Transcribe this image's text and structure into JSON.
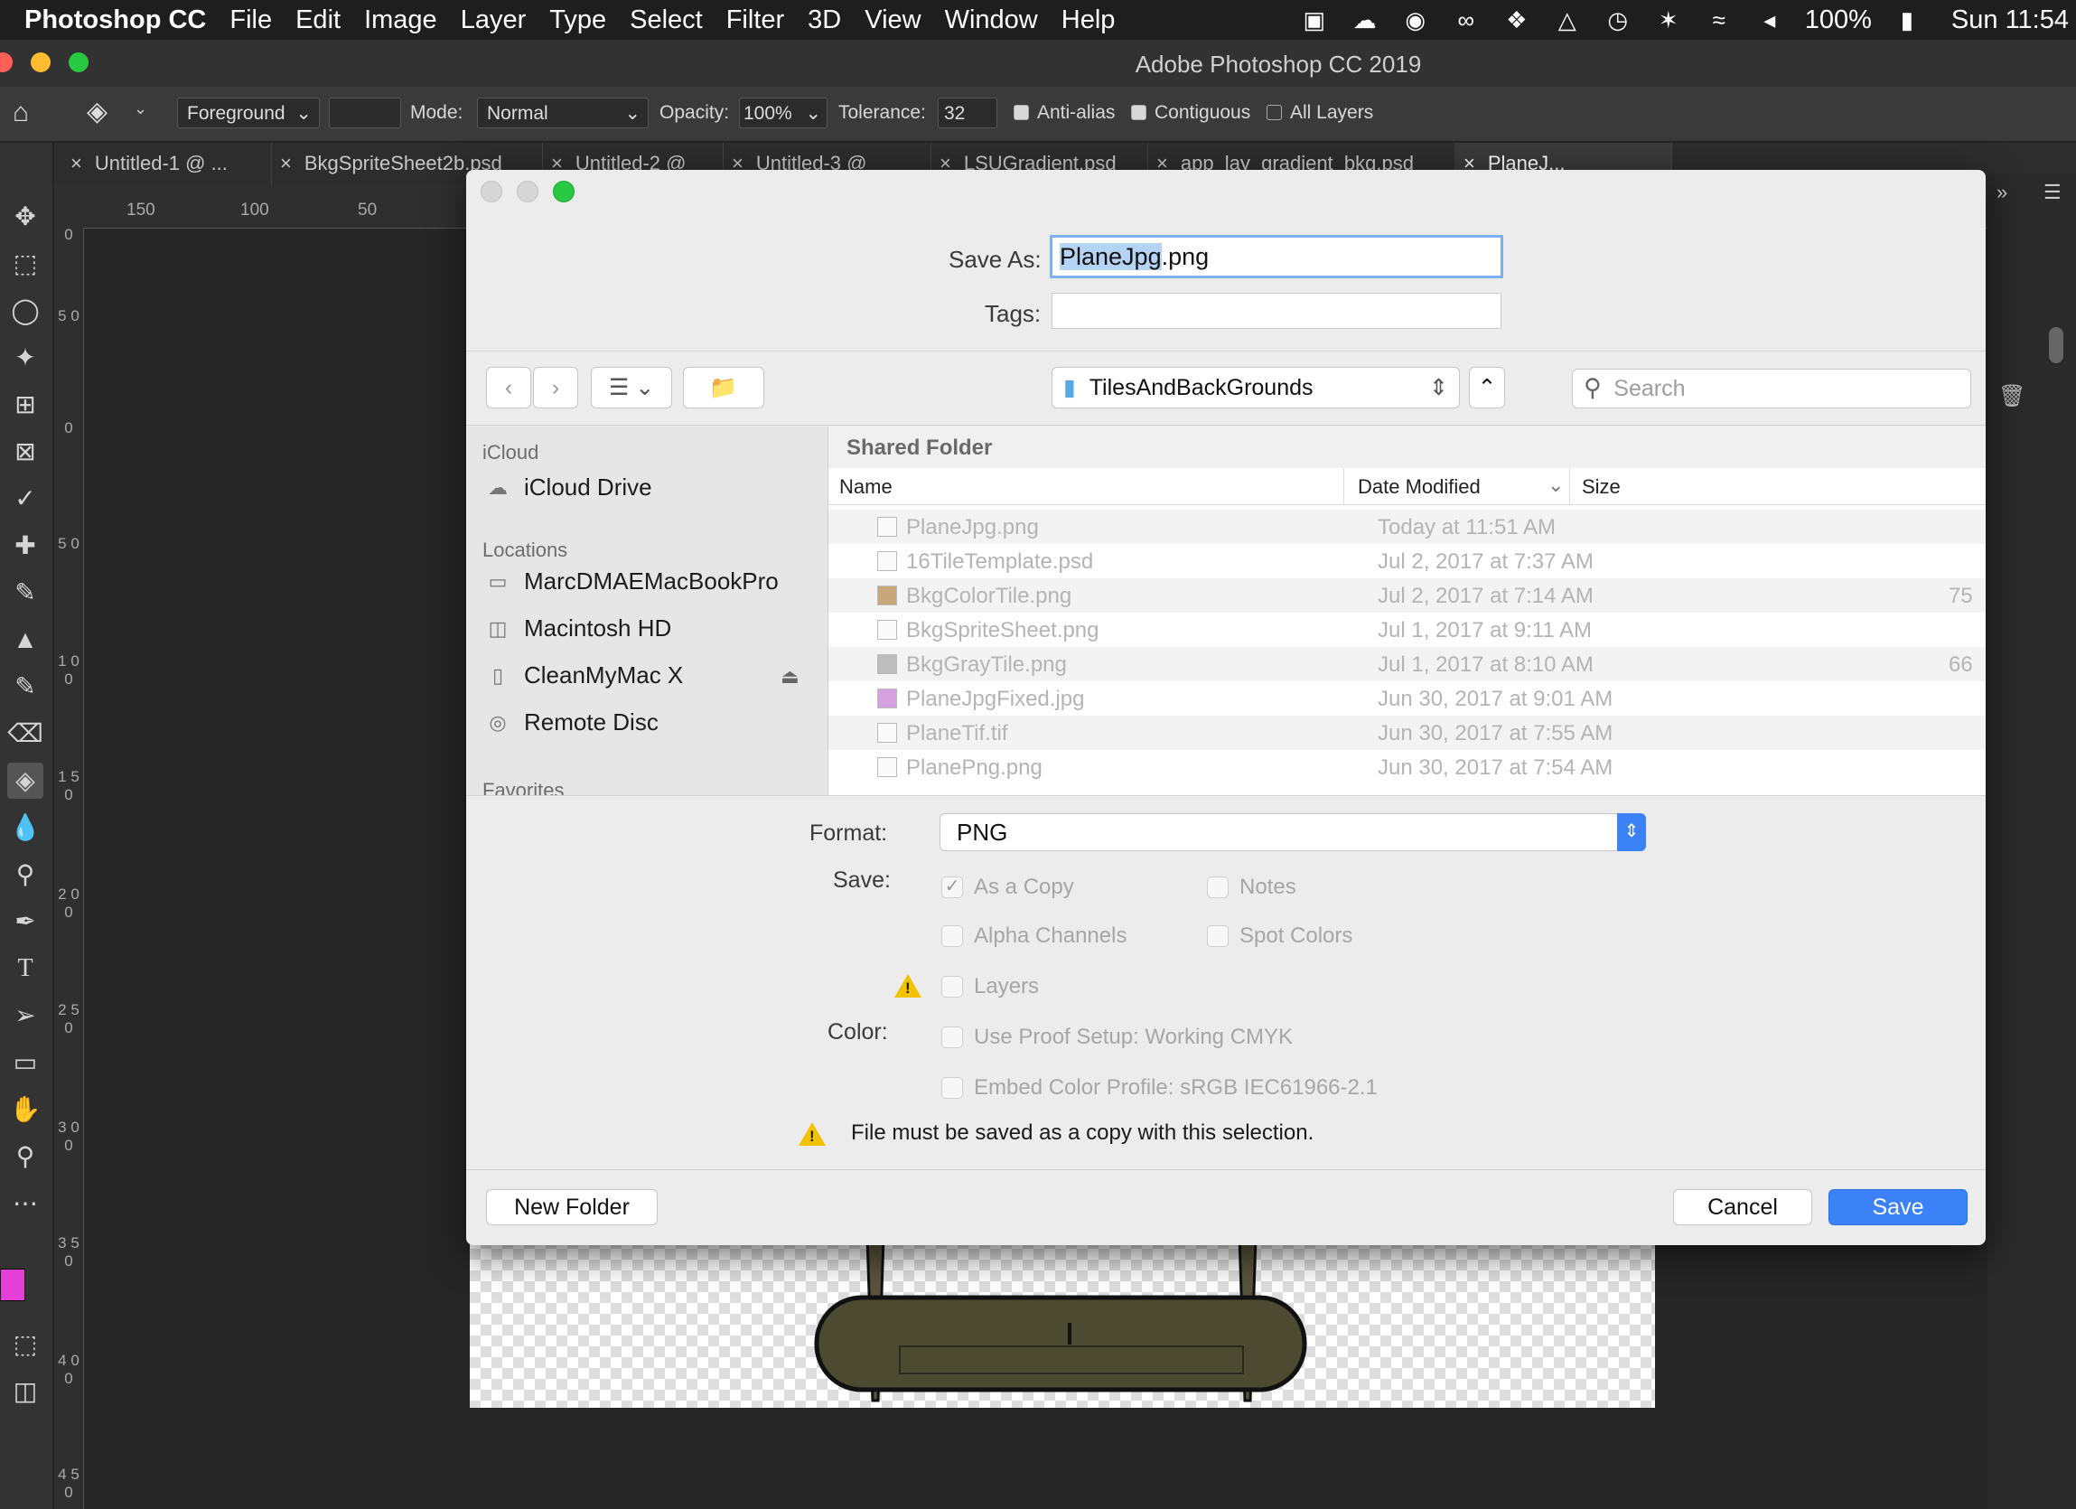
{
  "menubar": {
    "app": "Photoshop CC",
    "items": [
      "File",
      "Edit",
      "Image",
      "Layer",
      "Type",
      "Select",
      "Filter",
      "3D",
      "View",
      "Window",
      "Help"
    ],
    "battery": "100%",
    "clock": "Sun 11:54"
  },
  "window_title": "Adobe Photoshop CC 2019",
  "options": {
    "fill_source": "Foreground",
    "mode_label": "Mode:",
    "mode_value": "Normal",
    "opacity_label": "Opacity:",
    "opacity_value": "100%",
    "tolerance_label": "Tolerance:",
    "tolerance_value": "32",
    "anti_alias": "Anti-alias",
    "contiguous": "Contiguous",
    "all_layers": "All Layers"
  },
  "doc_tabs": [
    "Untitled-1 @ ...",
    "BkgSpriteSheet2b.psd",
    "Untitled-2 @",
    "Untitled-3 @",
    "LSUGradient.psd",
    "app_lay_gradient_bkg.psd",
    "PlaneJ..."
  ],
  "ruler": {
    "labels": [
      "150",
      "100",
      "50"
    ],
    "left_labels": [
      "0",
      "5 0",
      "0",
      "5 0",
      "1 0 0",
      "1 5 0",
      "2 0 0",
      "2 5 0",
      "3 0 0",
      "3 5 0",
      "4 0 0",
      "4 5 0"
    ]
  },
  "dialog": {
    "save_as_label": "Save As:",
    "save_as_value": "PlaneJpg.png",
    "save_as_selected": "PlaneJpg",
    "save_as_ext": ".png",
    "tags_label": "Tags:",
    "location": "TilesAndBackGrounds",
    "search_placeholder": "Search",
    "sidebar": {
      "icloud_header": "iCloud",
      "icloud_drive": "iCloud Drive",
      "locations_header": "Locations",
      "locations": [
        "MarcDMAEMacBookPro",
        "Macintosh HD",
        "CleanMyMac X",
        "Remote Disc"
      ],
      "favorites_header": "Favorites"
    },
    "shared_folder": "Shared Folder",
    "columns": {
      "name": "Name",
      "date": "Date Modified",
      "size": "Size"
    },
    "files": [
      {
        "name": "PlaneJpg.png",
        "date": "Today at 11:51 AM",
        "size": ""
      },
      {
        "name": "16TileTemplate.psd",
        "date": "Jul 2, 2017 at 7:37 AM",
        "size": ""
      },
      {
        "name": "BkgColorTile.png",
        "date": "Jul 2, 2017 at 7:14 AM",
        "size": "75"
      },
      {
        "name": "BkgSpriteSheet.png",
        "date": "Jul 1, 2017 at 9:11 AM",
        "size": ""
      },
      {
        "name": "BkgGrayTile.png",
        "date": "Jul 1, 2017 at 8:10 AM",
        "size": "66"
      },
      {
        "name": "PlaneJpgFixed.jpg",
        "date": "Jun 30, 2017 at 9:01 AM",
        "size": ""
      },
      {
        "name": "PlaneTif.tif",
        "date": "Jun 30, 2017 at 7:55 AM",
        "size": ""
      },
      {
        "name": "PlanePng.png",
        "date": "Jun 30, 2017 at 7:54 AM",
        "size": ""
      }
    ],
    "format_label": "Format:",
    "format_value": "PNG",
    "save_label": "Save:",
    "options": {
      "as_a_copy": "As a Copy",
      "notes": "Notes",
      "alpha_channels": "Alpha Channels",
      "spot_colors": "Spot Colors",
      "layers": "Layers"
    },
    "color_label": "Color:",
    "use_proof": "Use Proof Setup:  Working CMYK",
    "embed_profile": "Embed Color Profile:  sRGB IEC61966-2.1",
    "warning": "File must be saved as a copy with this selection.",
    "new_folder": "New Folder",
    "cancel": "Cancel",
    "save": "Save"
  },
  "colors": {
    "accent": "#3b82f6",
    "foreground_swatch": "#e63fd8",
    "background_swatch": "#000000",
    "selection": "#b4d3f5"
  }
}
